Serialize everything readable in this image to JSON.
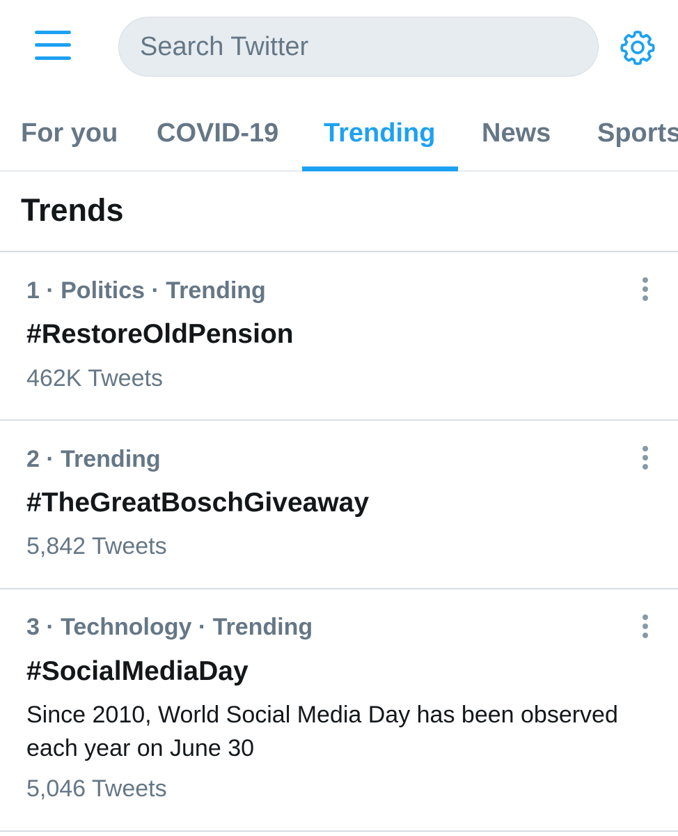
{
  "search": {
    "placeholder": "Search Twitter"
  },
  "icons": {
    "menu": "hamburger-menu-icon",
    "settings": "gear-icon",
    "more": "more-vertical-icon"
  },
  "colors": {
    "accent": "#1da1f2",
    "secondary_text": "#657786",
    "primary_text": "#14171a"
  },
  "tabs": [
    {
      "label": "For you"
    },
    {
      "label": "COVID-19"
    },
    {
      "label": "Trending",
      "active": true
    },
    {
      "label": "News"
    },
    {
      "label": "Sports"
    }
  ],
  "section_title": "Trends",
  "trends": [
    {
      "meta": "1 · Politics · Trending",
      "name": "#RestoreOldPension",
      "description": "",
      "count": "462K Tweets"
    },
    {
      "meta": "2 · Trending",
      "name": "#TheGreatBoschGiveaway",
      "description": "",
      "count": "5,842 Tweets"
    },
    {
      "meta": "3 · Technology · Trending",
      "name": "#SocialMediaDay",
      "description": "Since 2010, World Social Media Day has been observed each year on June 30",
      "count": "5,046 Tweets"
    }
  ]
}
